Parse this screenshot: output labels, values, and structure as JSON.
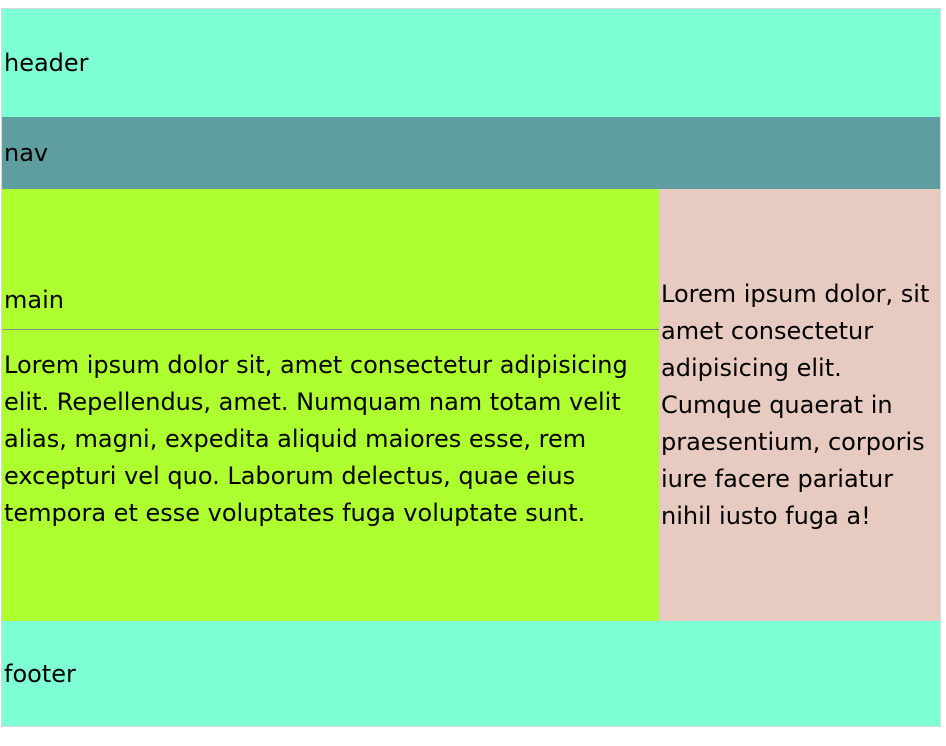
{
  "colors": {
    "header_bg": "#7fffd4",
    "nav_bg": "#5f9ea0",
    "main_bg": "#adff2f",
    "aside_bg": "#e8cbc0",
    "footer_bg": "#7fffd4"
  },
  "header": {
    "label": "header"
  },
  "nav": {
    "label": "nav"
  },
  "main": {
    "title": "main",
    "body": "Lorem ipsum dolor sit, amet consectetur adipisicing elit. Repellendus, amet. Numquam nam totam velit alias, magni, expedita aliquid maiores esse, rem excepturi vel quo. Laborum delectus, quae eius tempora et esse voluptates fuga voluptate sunt."
  },
  "aside": {
    "body": "Lorem ipsum dolor, sit amet consectetur adipisicing elit. Cumque quaerat in praesentium, corporis iure facere pariatur nihil iusto fuga a!"
  },
  "footer": {
    "label": "footer"
  }
}
